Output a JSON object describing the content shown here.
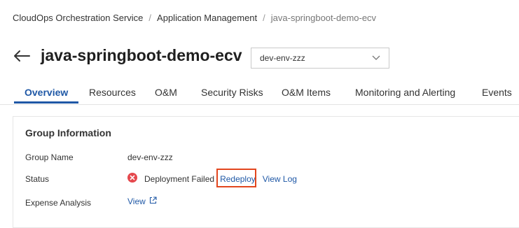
{
  "breadcrumb": {
    "items": [
      "CloudOps Orchestration Service",
      "Application Management",
      "java-springboot-demo-ecv"
    ],
    "separator": "/"
  },
  "header": {
    "title": "java-springboot-demo-ecv",
    "environment_select": "dev-env-zzz"
  },
  "tabs": [
    {
      "label": "Overview",
      "active": true
    },
    {
      "label": "Resources"
    },
    {
      "label": "O&M"
    },
    {
      "label": "Security Risks"
    },
    {
      "label": "O&M Items"
    },
    {
      "label": "Monitoring and Alerting"
    },
    {
      "label": "Events"
    }
  ],
  "group_info": {
    "title": "Group Information",
    "group_name_label": "Group Name",
    "group_name_value": "dev-env-zzz",
    "status_label": "Status",
    "status_text": "Deployment Failed",
    "redeploy_link": "Redeploy",
    "view_log_link": "View Log",
    "expense_label": "Expense Analysis",
    "expense_link": "View"
  },
  "colors": {
    "accent": "#1f58a6",
    "error": "#e5484d",
    "highlight": "#e2461e"
  },
  "icons": [
    "back-arrow-icon",
    "chevron-down-icon",
    "error-icon",
    "external-link-icon"
  ]
}
